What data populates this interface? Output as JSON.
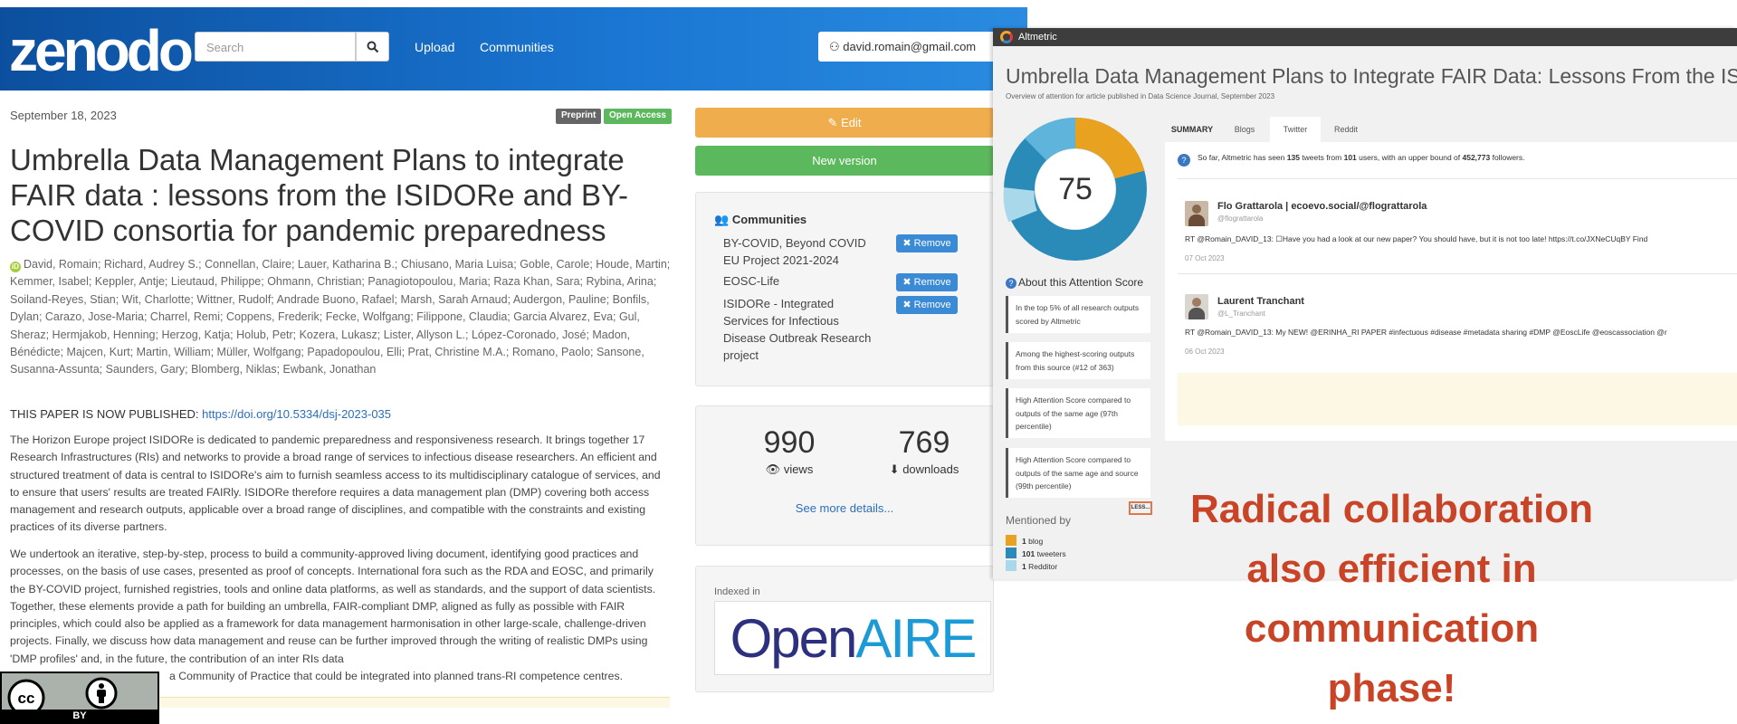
{
  "zenodo": {
    "logo": "zenodo",
    "search_placeholder": "Search",
    "nav": {
      "upload": "Upload",
      "communities": "Communities"
    },
    "user_email": "david.romain@gmail.com",
    "date": "September 18, 2023",
    "badges": [
      {
        "label": "Preprint",
        "color": "#666666"
      },
      {
        "label": "Open Access",
        "color": "#5cb85c"
      }
    ],
    "title": "Umbrella Data Management Plans to integrate FAIR data : lessons from the ISIDORe and BY-COVID consortia for pandemic preparedness",
    "authors": "David, Romain; Richard, Audrey S.; Connellan, Claire; Lauer, Katharina B.; Chiusano, Maria Luisa; Goble, Carole; Houde, Martin; Kemmer, Isabel; Keppler, Antje; Lieutaud, Philippe; Ohmann, Christian; Panagiotopoulou, Maria; Raza Khan, Sara; Rybina, Arina; Soiland-Reyes, Stian; Wit, Charlotte; Wittner, Rudolf; Andrade Buono, Rafael; Marsh, Sarah Arnaud; Audergon, Pauline; Bonfils, Dylan; Carazo, Jose-Maria; Charrel, Remi; Coppens, Frederik; Fecke, Wolfgang; Filippone, Claudia; Garcia Alvarez, Eva; Gul, Sheraz; Hermjakob, Henning; Herzog, Katja; Holub, Petr; Kozera, Lukasz; Lister, Allyson L.; López-Coronado, José; Madon, Bénédicte; Majcen, Kurt; Martin, William; Müller, Wolfgang; Papadopoulou, Elli; Prat, Christine M.A.; Romano, Paolo; Sansone, Susanna-Assunta; Saunders, Gary; Blomberg, Niklas; Ewbank, Jonathan",
    "published_prefix": "THIS PAPER IS NOW PUBLISHED: ",
    "published_link": "https://doi.org/10.5334/dsj-2023-035",
    "abstract_1": "The Horizon Europe project ISIDORe is dedicated to pandemic preparedness and responsiveness research. It brings together 17 Research Infrastructures (RIs) and networks to provide a broad range of services to infectious disease researchers. An efficient and structured treatment of data is central to ISIDORe's aim to furnish seamless access to its multidisciplinary catalogue of services, and to ensure that users' results are treated FAIRly. ISIDORe therefore requires a data management plan (DMP) covering both access management and research outputs, applicable over a broad range of disciplines, and compatible with the constraints and existing practices of its diverse partners.",
    "abstract_2a": "We undertook an iterative, step-by-step, process to build a community-approved living document, identifying good practices and processes, on the basis of use cases, presented as proof of concepts. International fora such as the RDA and EOSC, and primarily the BY-COVID project, furnished registries, tools and online data platforms, as well as standards, and the support of data scientists. Together, these elements provide a path for building an umbrella, FAIR-compliant DMP, aligned as fully as possible with FAIR principles, which could also be applied as a framework for data management harmonisation in other large-scale, challenge-driven projects. Finally, we discuss how data management and reuse can be further improved through the writing of realistic DMPs using 'DMP profiles' and, in the future, the contribution of an inter RIs data",
    "abstract_2b": "a Community of Practice that could be integrated into planned trans-RI competence centres.",
    "cc_label": "BY",
    "sidebar": {
      "edit_label": "Edit",
      "new_version_label": "New version",
      "communities_heading": "Communities",
      "communities": [
        {
          "name": "BY-COVID, Beyond COVID EU Project 2021-2024",
          "remove": "Remove"
        },
        {
          "name": "EOSC-Life",
          "remove": "Remove"
        },
        {
          "name": "ISIDORe - Integrated Services for Infectious Disease Outbreak Research project",
          "remove": "Remove"
        }
      ],
      "views": "990",
      "views_label": "views",
      "downloads": "769",
      "downloads_label": "downloads",
      "see_more": "See more details...",
      "indexed_in": "Indexed in",
      "openaire_1": "Open",
      "openaire_2": "AIRE"
    }
  },
  "altmetric": {
    "app_name": "Altmetric",
    "title": "Umbrella Data Management Plans to Integrate FAIR Data: Lessons From the ISIDOR",
    "subtitle": "Overview of attention for article published in Data Science Journal, September 2023",
    "score": "75",
    "about_label": "About this Attention Score",
    "facts": [
      "In the top 5% of all research outputs scored by Altmetric",
      "Among the highest-scoring outputs from this source (#12 of 363)",
      "High Attention Score compared to outputs of the same age (97th percentile)",
      "High Attention Score compared to outputs of the same age and source (99th percentile)"
    ],
    "less_label": "LESS...",
    "mentioned_by": "Mentioned by",
    "mentions": [
      {
        "count": "1",
        "label": "blog",
        "color": "#e8a21f"
      },
      {
        "count": "101",
        "label": "tweeters",
        "color": "#2a8ab8"
      },
      {
        "count": "1",
        "label": "Redditor",
        "color": "#a8d8ea"
      }
    ],
    "tabs": [
      "SUMMARY",
      "Blogs",
      "Twitter",
      "Reddit"
    ],
    "info_prefix": "So far, Altmetric has seen ",
    "info_tweets": "135",
    "info_mid1": " tweets from ",
    "info_users": "101",
    "info_mid2": " users, with an upper bound of ",
    "info_followers": "452,773",
    "info_suffix": " followers.",
    "tweets": [
      {
        "name": "Flo Grattarola | ecoevo.social/@flograttarola",
        "handle": "@flograttarola",
        "text": "RT @Romain_DAVID_13: ☐Have you had a look at our new paper? You should have, but it is not too late! https://t.co/JXNeCUqBY Find",
        "date": "07 Oct 2023"
      },
      {
        "name": "Laurent Tranchant",
        "handle": "@L_Tranchant",
        "text": "RT @Romain_DAVID_13: My NEW! @ERINHA_RI PAPER #infectuous #disease #metadata sharing #DMP @EoscLife @eoscassociation @r",
        "date": "06 Oct 2023"
      }
    ]
  },
  "overlay_text": {
    "line1": "Radical collaboration",
    "line2": "also efficient in",
    "line3": "communication",
    "line4": "phase!"
  },
  "colors": {
    "zenodo_header": "#1a76d2",
    "edit_button": "#f0ad4e",
    "new_version_button": "#5cb85c",
    "remove_button": "#3a8ad6",
    "overlay_text": "#c94327",
    "openaire_dark": "#2d2f7f",
    "openaire_light": "#1a9ad6"
  }
}
